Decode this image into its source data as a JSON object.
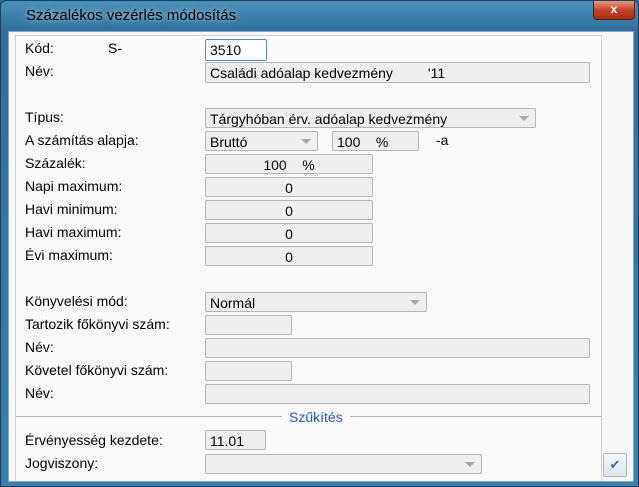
{
  "window": {
    "title": "Százalékos vezérlés módosítás",
    "close_label": "x"
  },
  "form": {
    "kod_label": "Kód:",
    "kod_prefix": "S-",
    "kod_value": "3510",
    "nev_label": "Név:",
    "nev_value": "Családi adóalap kedvezmény         '11",
    "tipus_label": "Típus:",
    "tipus_value": "Tárgyhóban érv. adóalap kedvezmény",
    "alap_label": "A számítás alapja:",
    "alap_value": "Bruttó",
    "alap_pct": "100    %",
    "alap_suffix": "-a",
    "szazalek_label": "Százalék:",
    "szazalek_value": "100    %",
    "napi_max_label": "Napi maximum:",
    "napi_max_value": "0",
    "havi_min_label": "Havi minimum:",
    "havi_min_value": "0",
    "havi_max_label": "Havi maximum:",
    "havi_max_value": "0",
    "evi_max_label": "Évi maximum:",
    "evi_max_value": "0",
    "konyv_label": "Könyvelési mód:",
    "konyv_value": "Normál",
    "tartozik_label": "Tartozik főkönyvi szám:",
    "tartozik_value": "",
    "tartozik_nev_label": "Név:",
    "tartozik_nev_value": "",
    "kovetel_label": "Követel főkönyvi szám:",
    "kovetel_value": "",
    "kovetel_nev_label": "Név:",
    "kovetel_nev_value": ""
  },
  "szukites": {
    "title": "Szűkítés",
    "erv_label": "Érvényesség kezdete:",
    "erv_value": "11.01",
    "jog_label": "Jogviszony:",
    "jog_value": ""
  }
}
